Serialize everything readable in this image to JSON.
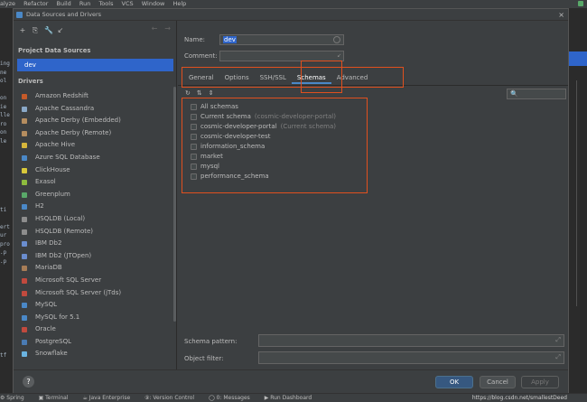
{
  "menubar": {
    "items": [
      "alyze",
      "Refactor",
      "Build",
      "Run",
      "Tools",
      "VCS",
      "Window",
      "Help"
    ]
  },
  "ide_left": [
    "",
    "",
    "",
    "",
    "",
    "",
    "ing",
    "ne",
    "ol",
    "",
    "on",
    "ie",
    "lle",
    "ro",
    "on",
    "le",
    "",
    "",
    "",
    "",
    "",
    "",
    "",
    "ti",
    "",
    "ert",
    "ur",
    "pro",
    ".p",
    ".p",
    "",
    "",
    "",
    "",
    "",
    "",
    "",
    "",
    "",
    "",
    "tf",
    "",
    ""
  ],
  "dialog": {
    "title": "Data Sources and Drivers",
    "close": "×"
  },
  "left_panel": {
    "toolbar": [
      "+",
      "⎘",
      "🔧",
      "↙"
    ],
    "nav": [
      "←",
      "→"
    ],
    "project_section": "Project Data Sources",
    "selected_source": "dev",
    "drivers_section": "Drivers",
    "drivers": [
      {
        "name": "Amazon Redshift",
        "color": "#c55a29"
      },
      {
        "name": "Apache Cassandra",
        "color": "#8aa8c7"
      },
      {
        "name": "Apache Derby (Embedded)",
        "color": "#b58d5f"
      },
      {
        "name": "Apache Derby (Remote)",
        "color": "#b58d5f"
      },
      {
        "name": "Apache Hive",
        "color": "#d6b63b"
      },
      {
        "name": "Azure SQL Database",
        "color": "#4a88c7"
      },
      {
        "name": "ClickHouse",
        "color": "#d8c83a"
      },
      {
        "name": "Exasol",
        "color": "#8dbb3e"
      },
      {
        "name": "Greenplum",
        "color": "#59a869"
      },
      {
        "name": "H2",
        "color": "#4a88c7"
      },
      {
        "name": "HSQLDB (Local)",
        "color": "#8d8d8d"
      },
      {
        "name": "HSQLDB (Remote)",
        "color": "#8d8d8d"
      },
      {
        "name": "IBM Db2",
        "color": "#6a8dcf"
      },
      {
        "name": "IBM Db2 (JTOpen)",
        "color": "#6a8dcf"
      },
      {
        "name": "MariaDB",
        "color": "#a77d57"
      },
      {
        "name": "Microsoft SQL Server",
        "color": "#c14a3e"
      },
      {
        "name": "Microsoft SQL Server (jTds)",
        "color": "#c14a3e"
      },
      {
        "name": "MySQL",
        "color": "#4a88c7"
      },
      {
        "name": "MySQL for 5.1",
        "color": "#4a88c7"
      },
      {
        "name": "Oracle",
        "color": "#c14a3e"
      },
      {
        "name": "PostgreSQL",
        "color": "#4a7bb3"
      },
      {
        "name": "Snowflake",
        "color": "#6ab3e0"
      }
    ]
  },
  "right_panel": {
    "name_label": "Name:",
    "name_value": "dev",
    "comment_label": "Comment:",
    "tabs": [
      "General",
      "Options",
      "SSH/SSL",
      "Schemas",
      "Advanced"
    ],
    "active_tab": "Schemas",
    "schema_tools": [
      "↻",
      "⇅",
      "⇕"
    ],
    "search_icon": "🔍",
    "schemas": [
      {
        "name": "All schemas",
        "note": ""
      },
      {
        "name": "Current schema",
        "note": "(cosmic-developer-portal)"
      },
      {
        "name": "cosmic-developer-portal",
        "note": "(Current schema)"
      },
      {
        "name": "cosmic-developer-test",
        "note": ""
      },
      {
        "name": "information_schema",
        "note": ""
      },
      {
        "name": "market",
        "note": ""
      },
      {
        "name": "mysql",
        "note": ""
      },
      {
        "name": "performance_schema",
        "note": ""
      }
    ],
    "schema_pattern_label": "Schema pattern:",
    "object_filter_label": "Object filter:",
    "expand_icon": "⤢"
  },
  "footer": {
    "help": "?",
    "ok": "OK",
    "cancel": "Cancel",
    "apply": "Apply"
  },
  "toolstrip": {
    "items": [
      "⚙ Spring",
      "▣ Terminal",
      "☕ Java Enterprise",
      "⑨: Version Control",
      "◯ 0: Messages",
      "▶ Run Dashboard"
    ],
    "watermark": "https://blog.csdn.net/smallestDeed"
  },
  "colors": {
    "accent": "#2f65ca",
    "highlight": "#e0501e",
    "background": "#3c3f41"
  }
}
